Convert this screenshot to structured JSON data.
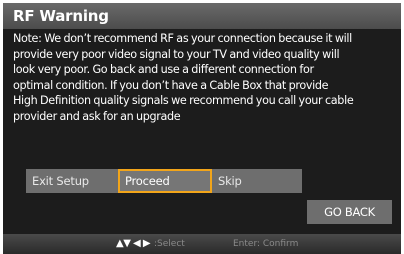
{
  "dialog": {
    "title": "RF Warning",
    "message_lines": [
      "Note: We don’t recommend RF as your connection because it will",
      "provide very poor video signal to your TV and video quality will",
      "look very poor. Go back and use a different connection for",
      "optimal condition. If you don’t have a Cable Box that provide",
      "High Definition quality signals we recommend you call your cable",
      "provider and ask for an upgrade"
    ]
  },
  "buttons": {
    "exit_setup": "Exit Setup",
    "proceed": "Proceed",
    "skip": "Skip",
    "go_back": "GO BACK"
  },
  "footer": {
    "nav_arrows": "▲▼ ◀ ▶",
    "select_label": ":Select",
    "confirm_label": "Enter: Confirm"
  },
  "colors": {
    "focus_border": "#f2a51a",
    "button_bg": "#6e6e6e",
    "background": "#1c1c1c"
  },
  "focused_button": "proceed"
}
